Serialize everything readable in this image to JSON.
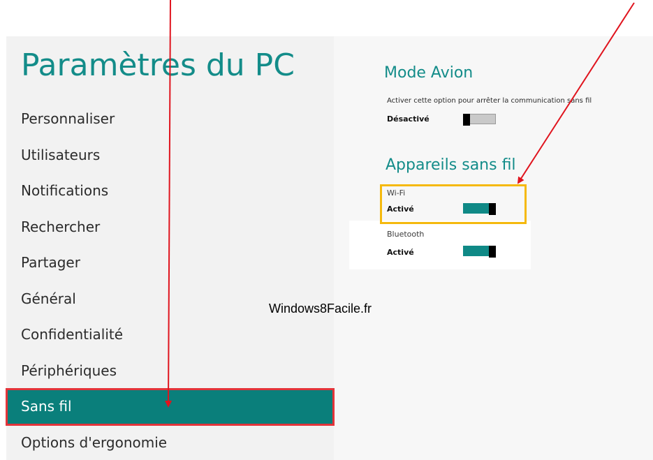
{
  "page": {
    "title": "Paramètres du PC"
  },
  "sidebar": {
    "items": [
      {
        "label": "Personnaliser"
      },
      {
        "label": "Utilisateurs"
      },
      {
        "label": "Notifications"
      },
      {
        "label": "Rechercher"
      },
      {
        "label": "Partager"
      },
      {
        "label": "Général"
      },
      {
        "label": "Confidentialité"
      },
      {
        "label": "Périphériques"
      },
      {
        "label": "Sans fil",
        "selected": true
      },
      {
        "label": "Options d'ergonomie"
      }
    ]
  },
  "main": {
    "airplane": {
      "heading": "Mode Avion",
      "description": "Activer cette option pour arrêter la communication sans fil",
      "state": "Désactivé",
      "on": false
    },
    "wireless": {
      "heading": "Appareils sans fil",
      "devices": [
        {
          "name": "Wi-Fi",
          "state": "Activé",
          "on": true
        },
        {
          "name": "Bluetooth",
          "state": "Activé",
          "on": true
        }
      ]
    }
  },
  "watermark": "Windows8Facile.fr",
  "colors": {
    "accent": "#138c89",
    "selection_bg": "#0a7f7b",
    "selection_border": "#e3343a",
    "highlight": "#f5b90e",
    "annotation_arrow": "#e0141e"
  }
}
